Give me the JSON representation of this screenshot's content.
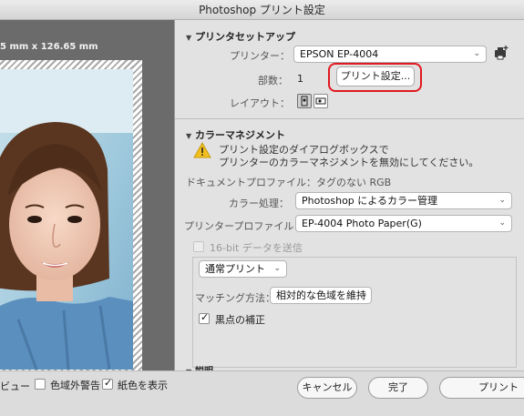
{
  "window": {
    "title": "Photoshop プリント設定"
  },
  "preview": {
    "dimensions": "5 mm x 126.65 mm"
  },
  "printer_setup": {
    "heading": "プリンタセットアップ",
    "printer_label": "プリンター：",
    "printer_value": "EPSON EP-4004",
    "copies_label": "部数：",
    "copies_value": "1",
    "print_settings_button": "プリント設定...",
    "layout_label": "レイアウト："
  },
  "color_management": {
    "heading": "カラーマネジメント",
    "warning_line1": "プリント設定のダイアログボックスで",
    "warning_line2": "プリンターのカラーマネジメントを無効にしてください。",
    "document_profile": "ドキュメントプロファイル：タグのない RGB",
    "color_handling_label": "カラー処理：",
    "color_handling_value": "Photoshop によるカラー管理",
    "printer_profile_label": "プリンタープロファイル：",
    "printer_profile_value": "EP-4004 Photo Paper(G)",
    "send_16bit": "16-bit データを送信",
    "normal_print": "通常プリント",
    "matching_label": "マッチング方法：",
    "matching_value": "相対的な色域を維持",
    "black_point": "黒点の補正"
  },
  "description": {
    "heading": "説明"
  },
  "bottom": {
    "preview_label": "ビュー",
    "gamut_warning": "色域外警告",
    "show_paper_color": "紙色を表示",
    "cancel": "キャンセル",
    "done": "完了",
    "print": "プリント"
  },
  "colors": {
    "highlight": "#e0191f",
    "warning": "#f2c01e"
  }
}
